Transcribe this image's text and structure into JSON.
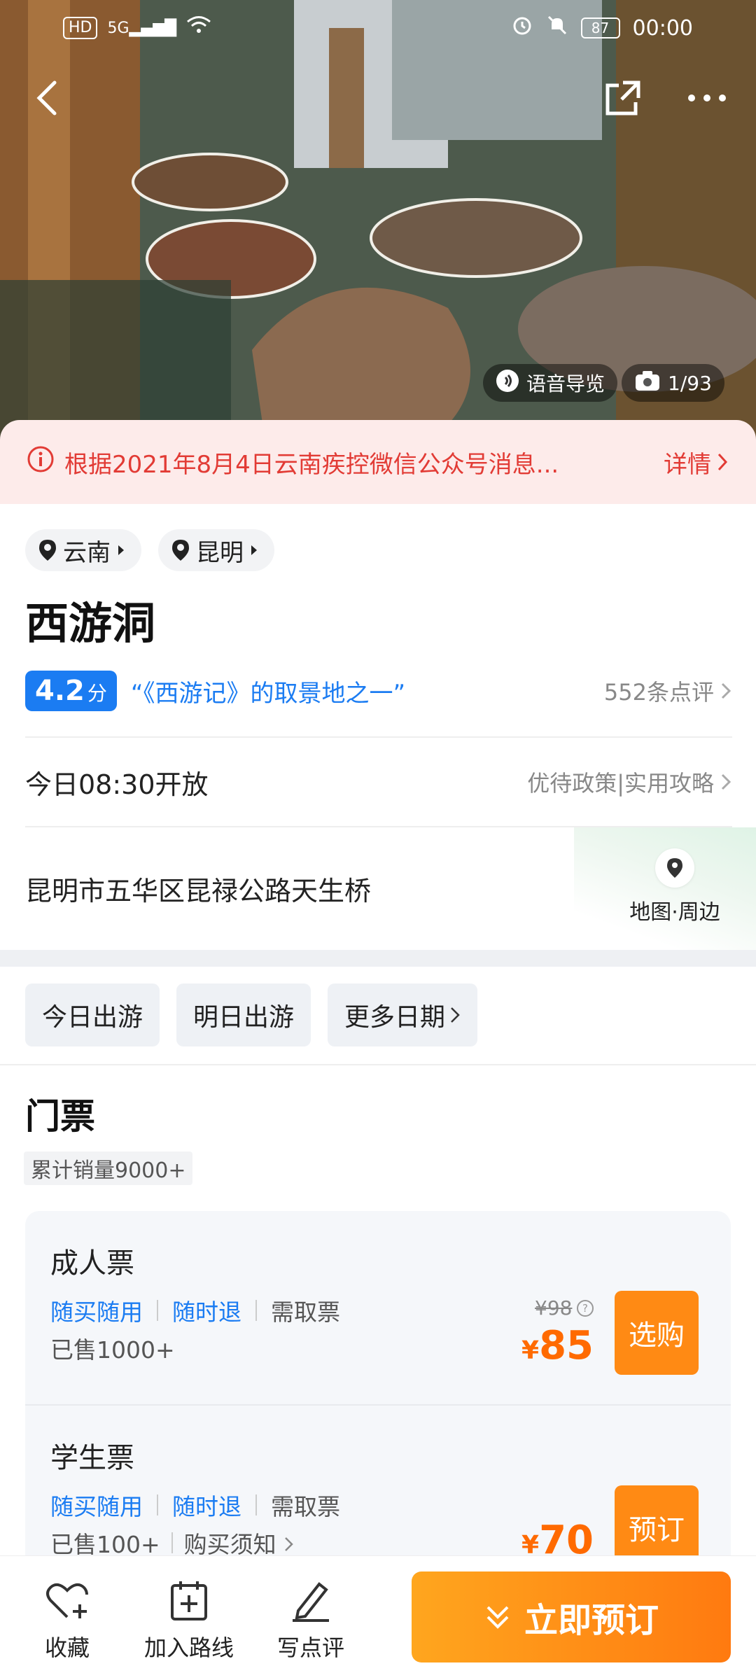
{
  "status_bar": {
    "hd": "HD",
    "signal": "5G",
    "battery": "87",
    "time": "00:00"
  },
  "hero": {
    "audio_guide": "语音导览",
    "photo_counter": "1/93",
    "icons": {
      "back": "back-arrow-icon",
      "share": "share-icon",
      "more": "more-dots-icon"
    }
  },
  "notice": {
    "text": "根据2021年8月4日云南疾控微信公众号消息...",
    "detail_label": "详情"
  },
  "location_tags": [
    "云南",
    "昆明"
  ],
  "attraction": {
    "name": "西游洞",
    "score": "4.2",
    "score_unit": "分",
    "highlight": "“《西游记》的取景地之一”",
    "reviews": "552条点评",
    "open_time": "今日08:30开放",
    "policy_links": "优待政策|实用攻略",
    "address": "昆明市五华区昆禄公路天生桥",
    "map_label": "地图·周边"
  },
  "date_tabs": [
    "今日出游",
    "明日出游",
    "更多日期"
  ],
  "tickets": {
    "title": "门票",
    "total_sales": "累计销量9000+",
    "items": [
      {
        "name": "成人票",
        "tag1": "随买随用",
        "tag2": "随时退",
        "tag3": "需取票",
        "sold": "已售1000+",
        "original_price": "¥98",
        "currency": "¥",
        "price": "85",
        "button": "选购"
      },
      {
        "name": "学生票",
        "tag1": "随买随用",
        "tag2": "随时退",
        "tag3": "需取票",
        "sold": "已售100+",
        "notice": "购买须知",
        "currency": "¥",
        "price": "70",
        "button": "预订"
      }
    ]
  },
  "bottom_bar": {
    "favorite": "收藏",
    "add_route": "加入路线",
    "write_review": "写点评",
    "book_now": "立即预订"
  },
  "colors": {
    "accent_blue": "#1b7cf2",
    "price_orange": "#ff6a00",
    "cta_orange": "#ff8a14",
    "notice_red": "#e23b35"
  }
}
